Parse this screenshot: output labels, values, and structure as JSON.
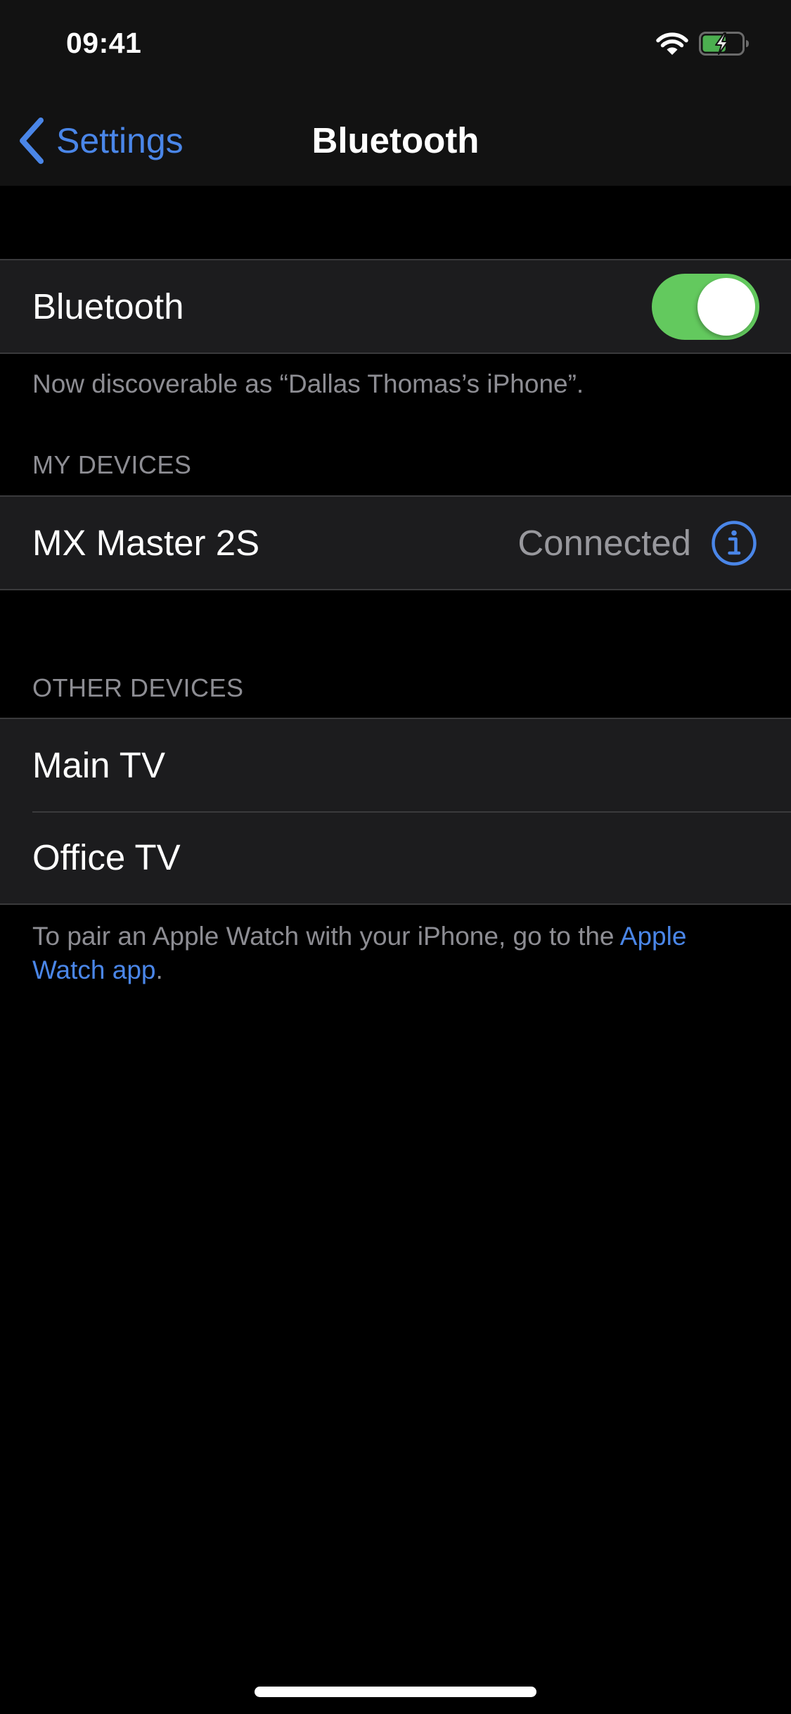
{
  "status_bar": {
    "time": "09:41",
    "wifi_icon": "wifi-icon",
    "battery_icon": "battery-charging-icon",
    "battery_level_percent": 60,
    "battery_charging": true
  },
  "nav": {
    "back_icon": "chevron-left-icon",
    "back_label": "Settings",
    "title": "Bluetooth"
  },
  "bluetooth": {
    "label": "Bluetooth",
    "enabled": true,
    "toggle_color": "#63c95e",
    "discoverable_text": "Now discoverable as “Dallas Thomas’s iPhone”."
  },
  "my_devices": {
    "header": "MY DEVICES",
    "items": [
      {
        "name": "MX Master 2S",
        "status": "Connected",
        "info_icon": "info-circle-icon"
      }
    ]
  },
  "other_devices": {
    "header": "OTHER DEVICES",
    "items": [
      {
        "name": "Main TV"
      },
      {
        "name": "Office TV"
      }
    ]
  },
  "footer": {
    "text": "To pair an Apple Watch with your iPhone, go to the ",
    "link_text": "Apple Watch app",
    "trailing": "."
  },
  "colors": {
    "accent": "#4a86e8",
    "background": "#000000",
    "cell_background": "#1c1c1e",
    "secondary_text": "#8d8d93",
    "toggle_on": "#63c95e",
    "battery_fill": "#4caf50"
  }
}
